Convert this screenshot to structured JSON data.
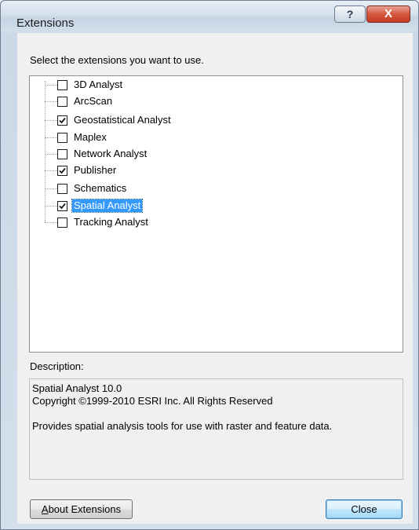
{
  "window": {
    "title": "Extensions",
    "help_label": "?",
    "close_label": "X"
  },
  "prompt": "Select the extensions you want to use.",
  "extensions": [
    {
      "label": "3D Analyst",
      "checked": false
    },
    {
      "label": "ArcScan",
      "checked": false
    },
    {
      "label": "Geostatistical Analyst",
      "checked": true
    },
    {
      "label": "Maplex",
      "checked": false
    },
    {
      "label": "Network Analyst",
      "checked": false
    },
    {
      "label": "Publisher",
      "checked": true
    },
    {
      "label": "Schematics",
      "checked": false
    },
    {
      "label": "Spatial Analyst",
      "checked": true,
      "selected": true
    },
    {
      "label": "Tracking Analyst",
      "checked": false
    }
  ],
  "description": {
    "caption": "Description:",
    "line1": "Spatial Analyst 10.0",
    "line2": "Copyright ©1999-2010 ESRI Inc. All Rights Reserved",
    "line3": "Provides spatial analysis tools for use with raster and feature data."
  },
  "buttons": {
    "about_first": "A",
    "about_rest": "bout Extensions",
    "close": "Close"
  }
}
